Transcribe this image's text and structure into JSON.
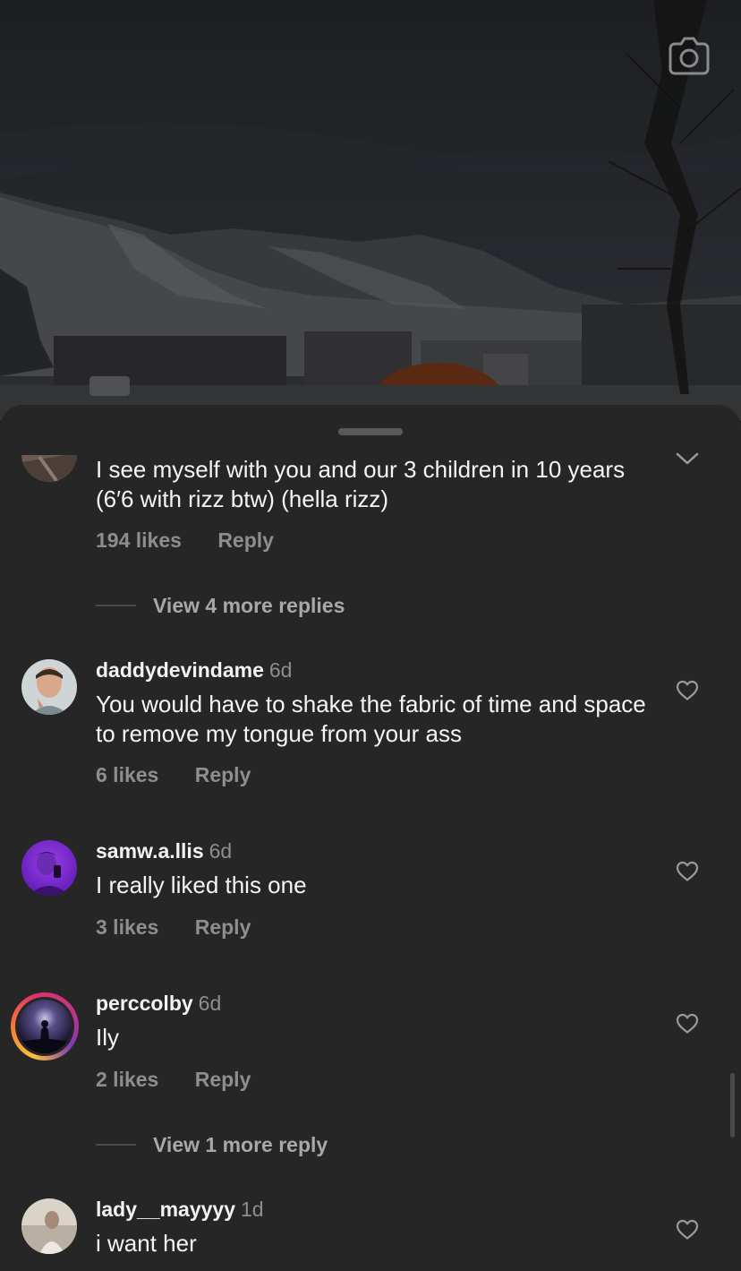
{
  "comments": [
    {
      "text": "I see myself with you and our 3 children in 10 years (6′6 with rizz btw) (hella rizz)",
      "likes": "194 likes",
      "reply_label": "Reply",
      "view_more": "View 4 more replies"
    },
    {
      "username": "daddydevindame",
      "time": "6d",
      "text": "You would have to shake the fabric of time and space to remove my tongue from your ass",
      "likes": "6 likes",
      "reply_label": "Reply"
    },
    {
      "username": "samw.a.llis",
      "time": "6d",
      "text": "I really liked this one",
      "likes": "3 likes",
      "reply_label": "Reply"
    },
    {
      "username": "perccolby",
      "time": "6d",
      "text": "Ily",
      "likes": "2 likes",
      "reply_label": "Reply",
      "view_more": "View 1 more reply"
    },
    {
      "username": "lady__mayyyy",
      "time": "1d",
      "text": "i want her"
    }
  ],
  "colors": {
    "sheet_bg": "#262626",
    "text_primary": "#f5f5f5",
    "text_secondary": "#8e8e8e"
  },
  "icons": {
    "camera": "camera-icon",
    "heart": "heart-outline-icon",
    "chevron": "chevron-down-icon"
  }
}
